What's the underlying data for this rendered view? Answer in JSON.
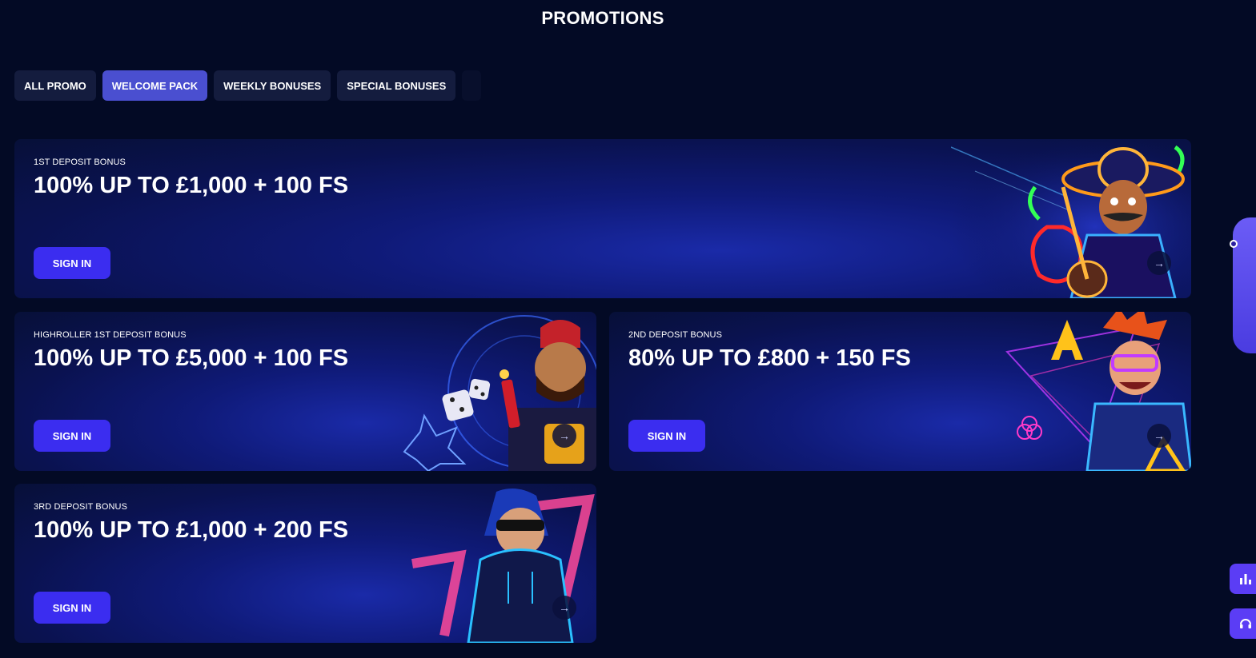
{
  "page": {
    "title": "PROMOTIONS"
  },
  "tabs": [
    {
      "label": "ALL PROMO",
      "active": false
    },
    {
      "label": "WELCOME PACK",
      "active": true
    },
    {
      "label": "WEEKLY BONUSES",
      "active": false
    },
    {
      "label": "SPECIAL BONUSES",
      "active": false
    }
  ],
  "promos": [
    {
      "eyebrow": "1ST DEPOSIT BONUS",
      "headline": "100% UP TO £1,000 + 100 FS",
      "button": "SIGN IN",
      "arrow_icon": "arrow-right-icon",
      "art": "mariachi-character"
    },
    {
      "eyebrow": "HIGHROLLER 1ST DEPOSIT BONUS",
      "headline": "100% UP TO £5,000 + 100 FS",
      "button": "SIGN IN",
      "arrow_icon": "arrow-right-icon",
      "art": "dynamite-character"
    },
    {
      "eyebrow": "2ND DEPOSIT BONUS",
      "headline": "80% UP TO £800 + 150 FS",
      "button": "SIGN IN",
      "arrow_icon": "arrow-right-icon",
      "art": "neon-gamer-character"
    },
    {
      "eyebrow": "3RD DEPOSIT BONUS",
      "headline": "100% UP TO £1,000 + 200 FS",
      "button": "SIGN IN",
      "arrow_icon": "arrow-right-icon",
      "art": "hoodie-sevens-character"
    }
  ],
  "side_widgets": {
    "wheel_icon": "fortune-wheel-icon",
    "stats_icon": "bar-chart-icon",
    "support_icon": "headset-icon"
  },
  "colors": {
    "background": "#030a25",
    "tab": "#141c3e",
    "tab_active": "#4a4fd0",
    "button": "#3b2df0",
    "side_accent": "#5b3df5"
  }
}
